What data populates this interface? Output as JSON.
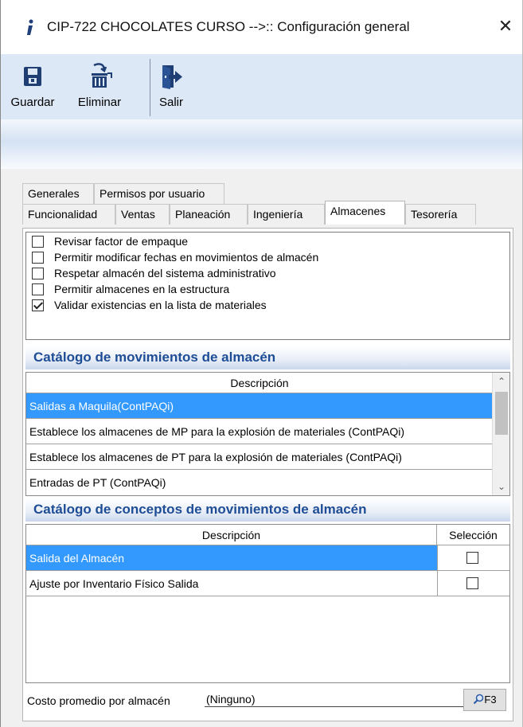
{
  "window": {
    "title": "CIP-722 CHOCOLATES CURSO -->:: Configuración general",
    "close_glyph": "✕"
  },
  "toolbar": {
    "buttons": [
      {
        "label": "Guardar",
        "icon": "save-icon"
      },
      {
        "label": "Eliminar",
        "icon": "delete-icon"
      },
      {
        "label": "Salir",
        "icon": "exit-icon"
      }
    ]
  },
  "tabs": {
    "row1": [
      "Generales",
      "Permisos por usuario"
    ],
    "row2": [
      "Funcionalidad",
      "Ventas",
      "Planeación",
      "Ingeniería",
      "Almacenes",
      "Tesorería"
    ],
    "active": "Almacenes"
  },
  "options": [
    {
      "label": "Revisar factor de empaque",
      "checked": false
    },
    {
      "label": "Permitir modificar fechas en movimientos de almacén",
      "checked": false
    },
    {
      "label": "Respetar almacén del sistema administrativo",
      "checked": false
    },
    {
      "label": "Permitir almacenes en la estructura",
      "checked": false
    },
    {
      "label": "Validar existencias en la lista de materiales",
      "checked": true
    }
  ],
  "movimientos": {
    "title": "Catálogo de movimientos de almacén",
    "column": "Descripción",
    "rows": [
      "Salidas a Maquila(ContPAQi)",
      "Establece los almacenes de MP para la explosión de materiales (ContPAQi)",
      "Establece los almacenes de PT para la explosión de materiales (ContPAQi)",
      "Entradas de PT (ContPAQi)"
    ],
    "selected_index": 0
  },
  "conceptos": {
    "title": "Catálogo de conceptos de movimientos de almacén",
    "columns": [
      "Descripción",
      "Selección"
    ],
    "rows": [
      {
        "label": "Salida del Almacén",
        "selected": false
      },
      {
        "label": "Ajuste por Inventario Físico Salida",
        "selected": false
      }
    ],
    "selected_index": 0
  },
  "footer": {
    "label": "Costo promedio por almacén",
    "value": "(Ninguno)",
    "lookup_label": "F3"
  }
}
